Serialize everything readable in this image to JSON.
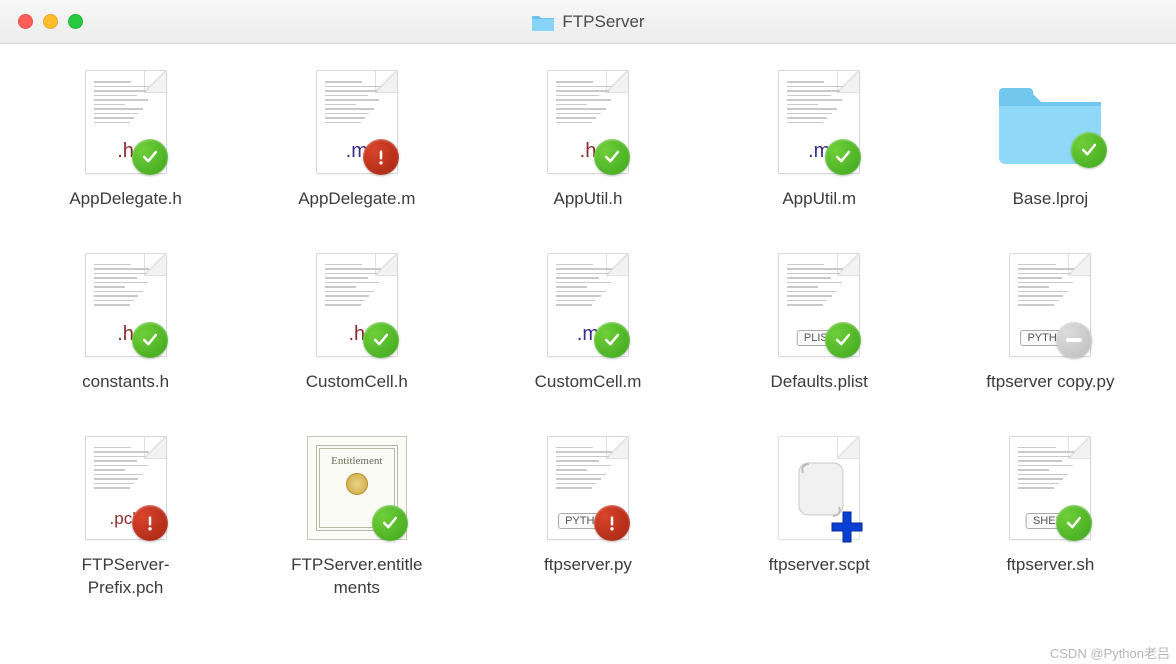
{
  "window": {
    "title": "FTPServer"
  },
  "watermark": "CSDN @Python老吕",
  "files": [
    {
      "label": "AppDelegate.h",
      "icon": "doc",
      "ext": ".h",
      "extClass": "ext-h",
      "status": "ok"
    },
    {
      "label": "AppDelegate.m",
      "icon": "doc",
      "ext": ".m",
      "extClass": "ext-m",
      "status": "alert"
    },
    {
      "label": "AppUtil.h",
      "icon": "doc",
      "ext": ".h",
      "extClass": "ext-h",
      "status": "ok"
    },
    {
      "label": "AppUtil.m",
      "icon": "doc",
      "ext": ".m",
      "extClass": "ext-m",
      "status": "ok"
    },
    {
      "label": "Base.lproj",
      "icon": "folder",
      "status": "ok"
    },
    {
      "label": "constants.h",
      "icon": "doc",
      "ext": ".h",
      "extClass": "ext-h",
      "status": "ok"
    },
    {
      "label": "CustomCell.h",
      "icon": "doc",
      "ext": ".h",
      "extClass": "ext-h",
      "status": "ok"
    },
    {
      "label": "CustomCell.m",
      "icon": "doc",
      "ext": ".m",
      "extClass": "ext-m",
      "status": "ok"
    },
    {
      "label": "Defaults.plist",
      "icon": "doc-tag",
      "tag": "PLIST",
      "status": "ok"
    },
    {
      "label": "ftpserver copy.py",
      "icon": "doc-tag",
      "tag": "PYTHON",
      "status": "ignored"
    },
    {
      "label": "FTPServer-\nPrefix.pch",
      "icon": "doc",
      "ext": ".pch",
      "extClass": "ext-pch",
      "status": "alert"
    },
    {
      "label": "FTPServer.entitle\nments",
      "icon": "cert",
      "status": "ok"
    },
    {
      "label": "ftpserver.py",
      "icon": "doc-tag",
      "tag": "PYTHON",
      "status": "alert"
    },
    {
      "label": "ftpserver.scpt",
      "icon": "scpt",
      "status": "add"
    },
    {
      "label": "ftpserver.sh",
      "icon": "doc-tag",
      "tag": "SHELL",
      "status": "ok"
    }
  ]
}
